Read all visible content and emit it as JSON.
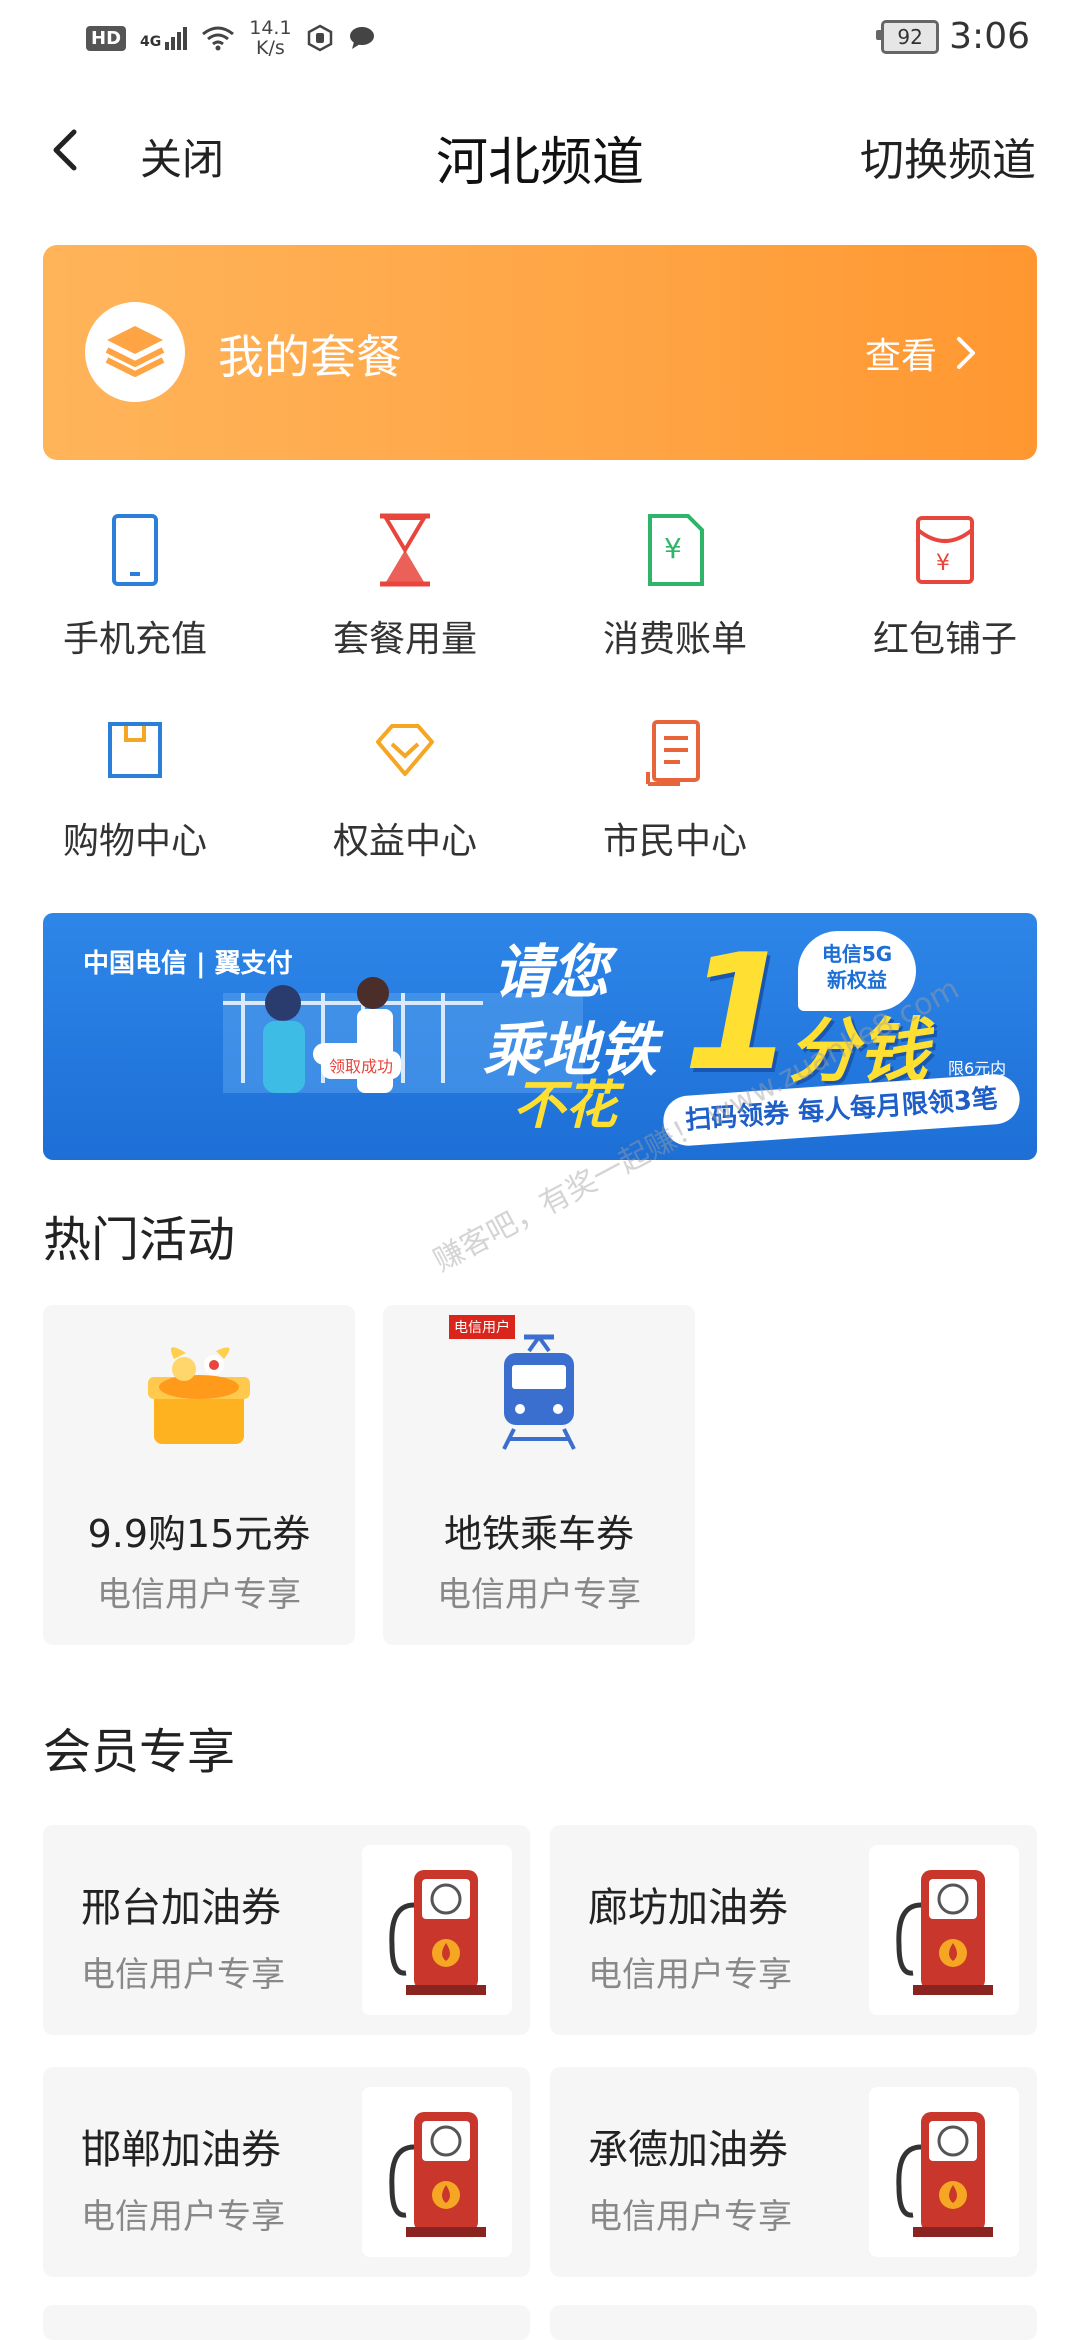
{
  "status_bar": {
    "hd": "HD",
    "net_type": "4G",
    "speed_value": "14.1",
    "speed_unit": "K/s",
    "battery": "92",
    "time": "3:06"
  },
  "nav": {
    "close_label": "关闭",
    "title": "河北频道",
    "switch_label": "切换频道"
  },
  "package": {
    "title": "我的套餐",
    "view_label": "查看"
  },
  "grid": [
    {
      "label": "手机充值",
      "icon": "phone-icon"
    },
    {
      "label": "套餐用量",
      "icon": "hourglass-icon"
    },
    {
      "label": "消费账单",
      "icon": "bill-icon"
    },
    {
      "label": "红包铺子",
      "icon": "red-envelope-icon"
    },
    {
      "label": "购物中心",
      "icon": "shopping-bag-icon"
    },
    {
      "label": "权益中心",
      "icon": "diamond-icon"
    },
    {
      "label": "市民中心",
      "icon": "citizen-doc-icon"
    }
  ],
  "promo": {
    "brand": "中国电信 | 翼支付",
    "line1": "请您",
    "line2": "乘地铁",
    "line3": "不花",
    "big_number": "1",
    "big_unit": "分钱",
    "limit_note": "限6元内",
    "badge_line1": "电信5G",
    "badge_line2": "新权益",
    "tag": "扫码领券  每人每月限领3笔",
    "toast": "领取成功"
  },
  "hot_section": {
    "title": "热门活动",
    "cards": [
      {
        "title": "9.9购15元券",
        "subtitle": "电信用户专享"
      },
      {
        "title": "地铁乘车券",
        "subtitle": "电信用户专享",
        "tag": "电信用户"
      }
    ]
  },
  "member_section": {
    "title": "会员专享",
    "cards": [
      {
        "title": "邢台加油券",
        "subtitle": "电信用户专享"
      },
      {
        "title": "廊坊加油券",
        "subtitle": "电信用户专享"
      },
      {
        "title": "邯郸加油券",
        "subtitle": "电信用户专享"
      },
      {
        "title": "承德加油券",
        "subtitle": "电信用户专享"
      }
    ]
  },
  "watermark": "赚客吧，有奖一起赚！ www.zuanke8.com",
  "colors": {
    "accent_orange": "#ffa444",
    "promo_blue": "#1d6fd6",
    "icon_blue": "#2b7fd8",
    "icon_red": "#e8453c",
    "icon_green": "#2fb56a",
    "icon_orange": "#f5a623"
  }
}
